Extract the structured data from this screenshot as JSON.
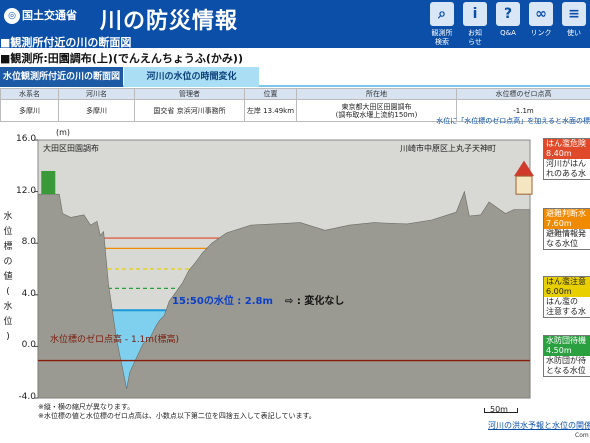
{
  "header": {
    "ministry": "国土交通省",
    "title": "川の防災情報",
    "subtitle": "観測所付近の川の断面図",
    "tools": [
      {
        "icon": "search-icon",
        "label1": "観測所",
        "label2": "検索"
      },
      {
        "icon": "info-icon",
        "label1": "お知",
        "label2": "らせ"
      },
      {
        "icon": "help-icon",
        "label1": "Q&A",
        "label2": ""
      },
      {
        "icon": "link-icon",
        "label1": "リンク",
        "label2": ""
      },
      {
        "icon": "guide-icon",
        "label1": "使い",
        "label2": ""
      }
    ]
  },
  "station": "観測所:田園調布(上)(でんえんちょうふ(かみ))",
  "tabs": {
    "active": "水位観測所付近の川の断面図",
    "inactive": "河川の水位の時間変化"
  },
  "info_table": {
    "headers": [
      "水系名",
      "河川名",
      "管理者",
      "位置",
      "所在地",
      "水位標のゼロ点高"
    ],
    "row": [
      "多摩川",
      "多摩川",
      "国交省 京浜河川事務所",
      "左岸 13.49km",
      "東京都大田区田園調布\n(調布取水堰上流約150m)",
      "-1.1m"
    ]
  },
  "note_top": "水位に「水位標のゼロ点高」を加えると水面の標",
  "chart_data": {
    "type": "area",
    "unit_label": "(m)",
    "ylim": [
      -4,
      16
    ],
    "yticks": [
      "16.0",
      "12.0",
      "8.0",
      "4.0",
      "0.0",
      "-4.0"
    ],
    "ytick_values": [
      16,
      12,
      8,
      4,
      0,
      -4
    ],
    "yaxis_title": [
      "水",
      "位",
      "標",
      "の",
      "値",
      "(",
      "水",
      "位",
      ")"
    ],
    "left_bank_label": "大田区田園調布",
    "right_bank_label": "川崎市中原区上丸子天神町",
    "water_level": 2.8,
    "readout_text": "15:50の水位 : 2.8m",
    "trend_text": "⇨ : 変化なし",
    "zero_point_label": "水位標のゼロ点高 - 1.1m(標高)",
    "zero_point_y": -1.1,
    "thresholds": [
      {
        "name": "はん濫危険水位",
        "value": 8.4,
        "label": "はん濫危険",
        "value_label": "8.40m",
        "desc": [
          "河川がはん",
          "れのある水"
        ],
        "color": "#e04a2a"
      },
      {
        "name": "避難判断水位",
        "value": 7.6,
        "label": "避難判断水",
        "value_label": "7.60m",
        "desc": [
          "避難情報発",
          "なる水位"
        ],
        "color": "#f08a00"
      },
      {
        "name": "はん濫注意水位",
        "value": 6.0,
        "label": "はん濫注意",
        "value_label": "6.00m",
        "desc": [
          "はん濫の",
          "注意する水"
        ],
        "color": "#e8d000"
      },
      {
        "name": "水防団待機水位",
        "value": 4.5,
        "label": "水防団待機",
        "value_label": "4.50m",
        "desc": [
          "水防団が待",
          "となる水位"
        ],
        "color": "#2aa040"
      }
    ],
    "section_profile": [
      [
        0,
        11.8
      ],
      [
        13,
        11.8
      ],
      [
        15,
        10.3
      ],
      [
        20,
        10.0
      ],
      [
        28,
        10.2
      ],
      [
        32,
        9.4
      ],
      [
        36,
        9.7
      ],
      [
        38,
        8.6
      ],
      [
        40,
        8.9
      ],
      [
        43,
        4.8
      ],
      [
        48,
        0.5
      ],
      [
        52,
        -2.0
      ],
      [
        54,
        -3.3
      ],
      [
        56,
        -2.0
      ],
      [
        60,
        -0.9
      ],
      [
        64,
        0.2
      ],
      [
        68,
        0.6
      ],
      [
        72,
        1.6
      ],
      [
        74,
        2.0
      ],
      [
        77,
        2.4
      ],
      [
        80,
        3.5
      ],
      [
        84,
        4.2
      ],
      [
        88,
        4.9
      ],
      [
        92,
        5.9
      ],
      [
        96,
        6.5
      ],
      [
        100,
        7.2
      ],
      [
        106,
        8.0
      ],
      [
        115,
        8.8
      ],
      [
        130,
        9.4
      ],
      [
        160,
        9.6
      ],
      [
        175,
        9.0
      ],
      [
        190,
        9.4
      ],
      [
        205,
        9.6
      ],
      [
        225,
        9.5
      ],
      [
        240,
        9.8
      ],
      [
        255,
        10.4
      ],
      [
        260,
        12.0
      ],
      [
        263,
        10.1
      ],
      [
        270,
        10.2
      ],
      [
        275,
        11.2
      ],
      [
        285,
        10.3
      ],
      [
        290,
        10.6
      ],
      [
        300,
        10.6
      ]
    ],
    "footnotes": [
      "※縦・横の縮尺が異なります。",
      "※水位標の値と水位標のゼロ点高は、小数点以下第二位を四捨五入して表記しています。"
    ],
    "scale_label": "50m"
  },
  "bottom_link": "河川の洪水予報と水位の関係",
  "bottom_small": "Com",
  "colors": {
    "header_bg": "#0b4fa8",
    "ground": "#9a9a92",
    "water": "#7fd0ee",
    "plot_bg": "#d8d8d4"
  }
}
